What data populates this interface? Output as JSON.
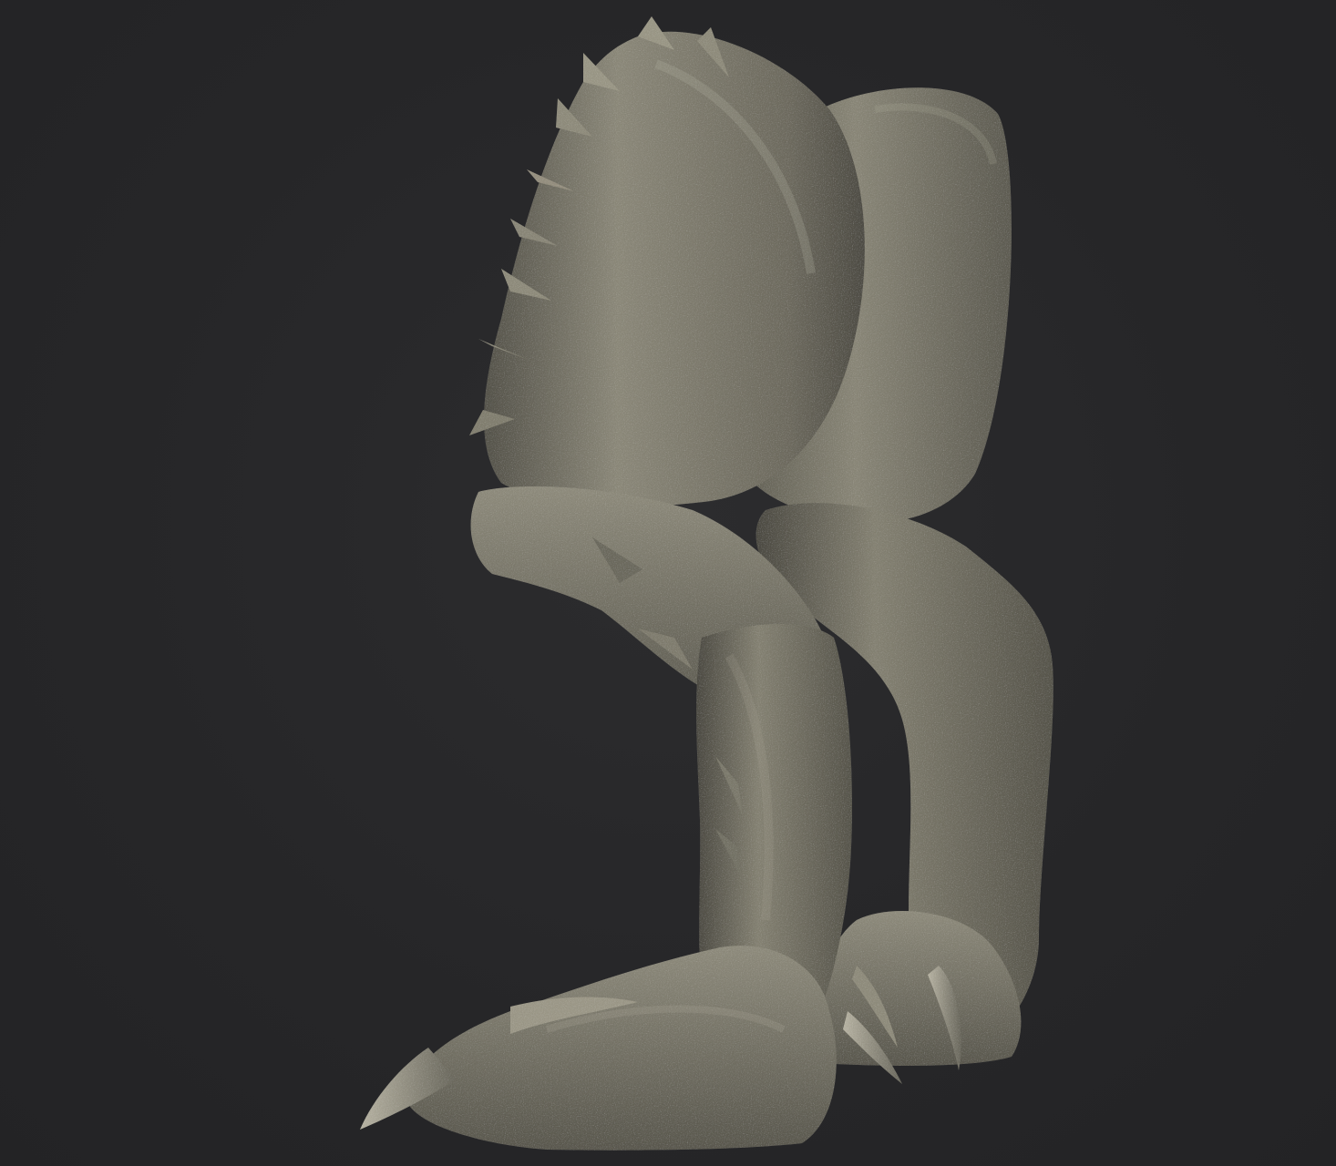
{
  "viewport": {
    "background_color": "#262628",
    "subject": "sculpted-creature-legs",
    "material_color": "#7d7a6c"
  }
}
